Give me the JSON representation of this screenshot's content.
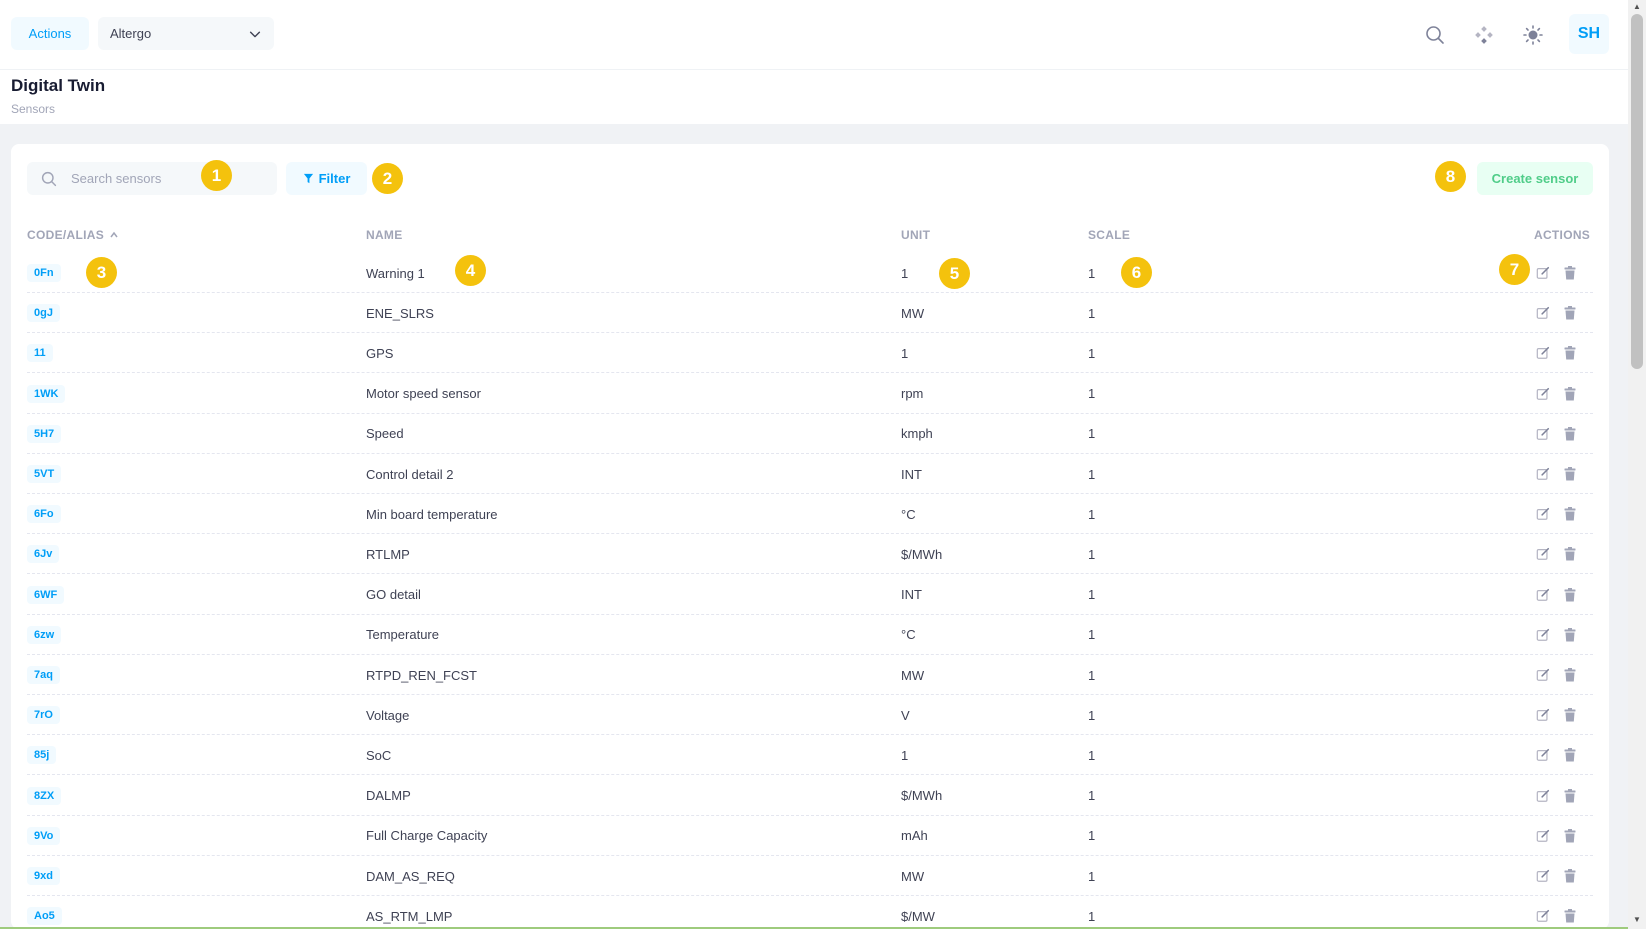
{
  "header": {
    "actions_label": "Actions",
    "org_selected": "Altergo",
    "avatar_initials": "SH"
  },
  "page": {
    "title": "Digital Twin",
    "subtitle": "Sensors"
  },
  "toolbar": {
    "search_placeholder": "Search sensors",
    "filter_label": "Filter",
    "create_label": "Create sensor"
  },
  "table": {
    "columns": {
      "code": "CODE/ALIAS",
      "name": "NAME",
      "unit": "UNIT",
      "scale": "SCALE",
      "actions": "ACTIONS"
    },
    "rows": [
      {
        "code": "0Fn",
        "name": "Warning 1",
        "unit": "1",
        "scale": "1"
      },
      {
        "code": "0gJ",
        "name": "ENE_SLRS",
        "unit": "MW",
        "scale": "1"
      },
      {
        "code": "11",
        "name": "GPS",
        "unit": "1",
        "scale": "1"
      },
      {
        "code": "1WK",
        "name": "Motor speed sensor",
        "unit": "rpm",
        "scale": "1"
      },
      {
        "code": "5H7",
        "name": "Speed",
        "unit": "kmph",
        "scale": "1"
      },
      {
        "code": "5VT",
        "name": "Control detail 2",
        "unit": "INT",
        "scale": "1"
      },
      {
        "code": "6Fo",
        "name": "Min board temperature",
        "unit": "°C",
        "scale": "1"
      },
      {
        "code": "6Jv",
        "name": "RTLMP",
        "unit": "$/MWh",
        "scale": "1"
      },
      {
        "code": "6WF",
        "name": "GO detail",
        "unit": "INT",
        "scale": "1"
      },
      {
        "code": "6zw",
        "name": "Temperature",
        "unit": "°C",
        "scale": "1"
      },
      {
        "code": "7aq",
        "name": "RTPD_REN_FCST",
        "unit": "MW",
        "scale": "1"
      },
      {
        "code": "7rO",
        "name": "Voltage",
        "unit": "V",
        "scale": "1"
      },
      {
        "code": "85j",
        "name": "SoC",
        "unit": "1",
        "scale": "1"
      },
      {
        "code": "8ZX",
        "name": "DALMP",
        "unit": "$/MWh",
        "scale": "1"
      },
      {
        "code": "9Vo",
        "name": "Full Charge Capacity",
        "unit": "mAh",
        "scale": "1"
      },
      {
        "code": "9xd",
        "name": "DAM_AS_REQ",
        "unit": "MW",
        "scale": "1"
      },
      {
        "code": "Ao5",
        "name": "AS_RTM_LMP",
        "unit": "$/MW",
        "scale": "1"
      }
    ]
  },
  "markers": [
    "1",
    "2",
    "3",
    "4",
    "5",
    "6",
    "7",
    "8"
  ],
  "colors": {
    "primary": "#009ef7",
    "primary_light": "#f1faff",
    "success": "#50cd89",
    "success_light": "#e8fff3",
    "marker": "#f4c20d",
    "muted": "#a1a5b7"
  }
}
